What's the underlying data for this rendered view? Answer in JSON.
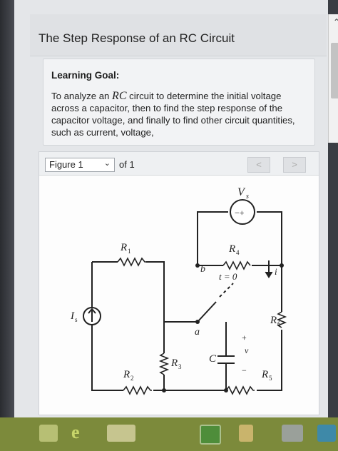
{
  "header": {
    "title": "The Step Response of an RC Circuit"
  },
  "learning_goal": {
    "heading": "Learning Goal:",
    "text_before": "To analyze an ",
    "rc": "RC",
    "text_after": " circuit to determine the initial voltage across a capacitor, then to find the step response of the capacitor voltage, and finally to find other circuit quantities, such as current, voltage,"
  },
  "figure_toolbar": {
    "selected": "Figure 1",
    "of_label": "of 1",
    "prev": "<",
    "next": ">"
  },
  "circuit": {
    "labels": {
      "vs": "V",
      "vs_sub": "s",
      "r1": "R",
      "r1_sub": "1",
      "r2": "R",
      "r2_sub": "2",
      "r3": "R",
      "r3_sub": "3",
      "r4": "R",
      "r4_sub": "4",
      "r5": "R",
      "r5_sub": "5",
      "r6": "R",
      "r6_sub": "6",
      "is": "I",
      "is_sub": "s",
      "c": "C",
      "v": "v",
      "plus": "+",
      "minus": "−",
      "i": "i",
      "node_a": "a",
      "node_b": "b",
      "switch_time": "t = 0",
      "vs_symbol": "−+"
    }
  }
}
